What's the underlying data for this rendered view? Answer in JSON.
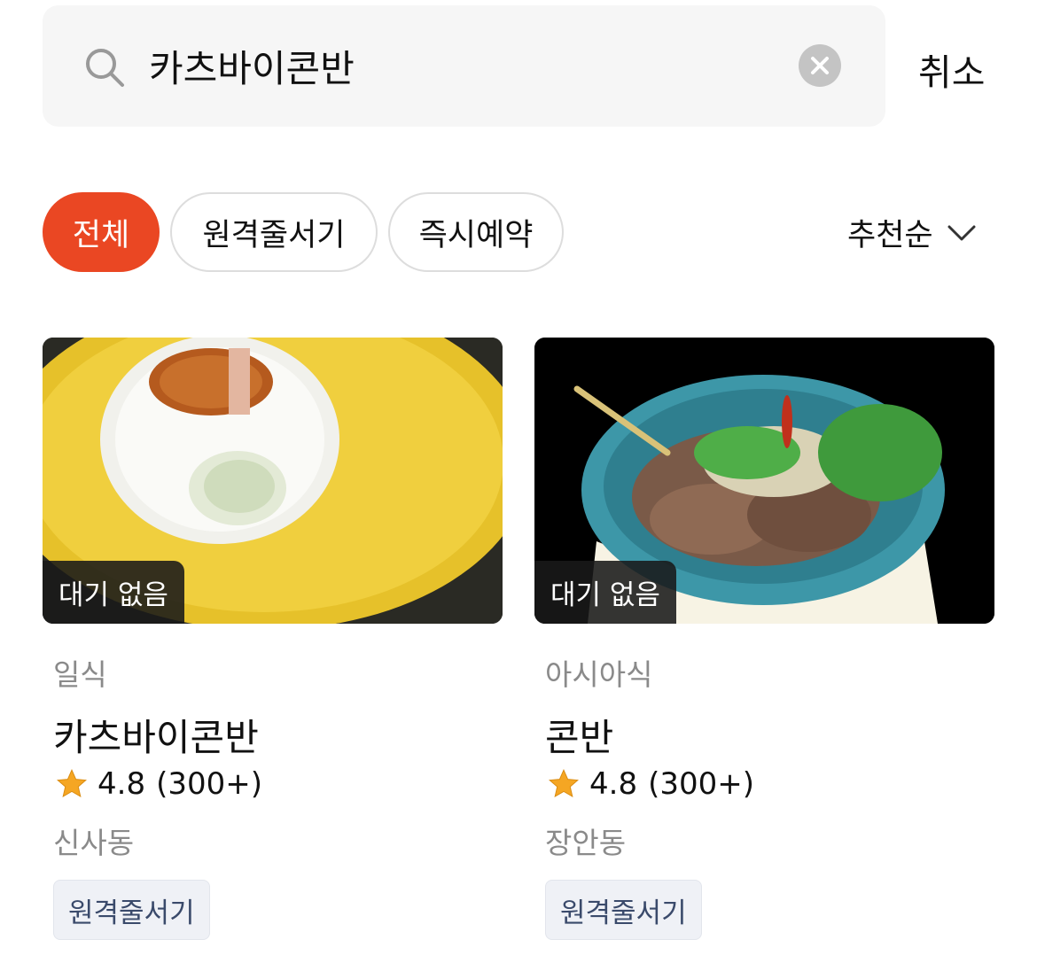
{
  "search": {
    "query": "카츠바이콘반",
    "cancel_label": "취소"
  },
  "filters": {
    "chips": [
      {
        "label": "전체",
        "active": true
      },
      {
        "label": "원격줄서기",
        "active": false
      },
      {
        "label": "즉시예약",
        "active": false
      }
    ],
    "sort_label": "추천순"
  },
  "results": [
    {
      "wait_badge": "대기 없음",
      "category": "일식",
      "name": "카츠바이콘반",
      "rating": "4.8",
      "review_count": "(300+)",
      "location": "신사동",
      "tag": "원격줄서기"
    },
    {
      "wait_badge": "대기 없음",
      "category": "아시아식",
      "name": "콘반",
      "rating": "4.8",
      "review_count": "(300+)",
      "location": "장안동",
      "tag": "원격줄서기"
    }
  ],
  "colors": {
    "accent": "#ea4723",
    "star": "#f5a623"
  }
}
